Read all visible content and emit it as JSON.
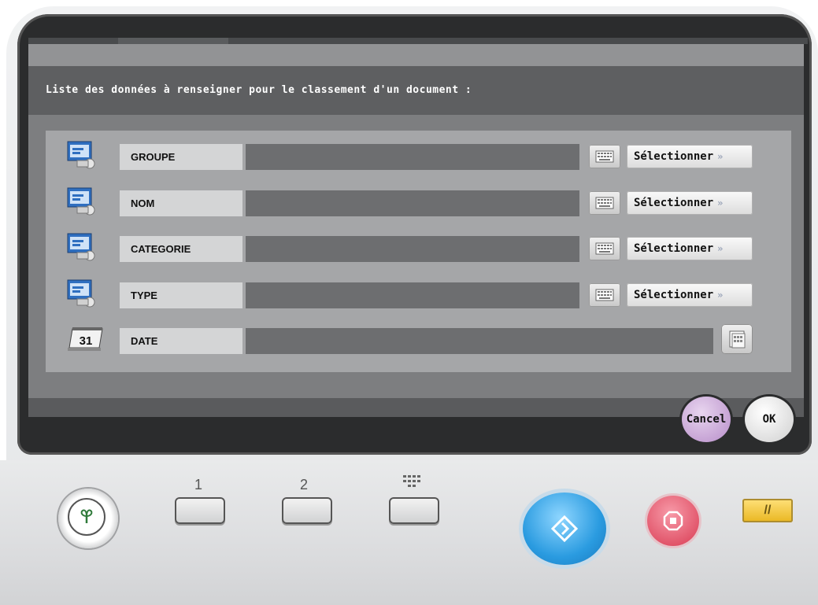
{
  "screen": {
    "instruction": "Liste des données à renseigner pour le classement d'un document :",
    "fields": [
      {
        "label": "GROUPE",
        "icon": "folder-list-icon",
        "select_label": "Sélectionner",
        "keyboard_icon": "keyboard-icon"
      },
      {
        "label": "NOM",
        "icon": "folder-list-icon",
        "select_label": "Sélectionner",
        "keyboard_icon": "keyboard-icon"
      },
      {
        "label": "CATEGORIE",
        "icon": "folder-list-icon",
        "select_label": "Sélectionner",
        "keyboard_icon": "keyboard-icon"
      },
      {
        "label": "TYPE",
        "icon": "folder-list-icon",
        "select_label": "Sélectionner",
        "keyboard_icon": "keyboard-icon"
      }
    ],
    "date_field": {
      "label": "DATE",
      "icon_text": "31",
      "icon": "calendar-icon",
      "picker_icon": "calendar-picker-icon"
    },
    "select_arrow": "»",
    "cancel_label": "Cancel",
    "ok_label": "OK"
  },
  "hardware": {
    "memory_1_label": "1",
    "memory_2_label": "2",
    "keypad_icon": "keypad-icon",
    "power_icon": "power-save-icon",
    "start_icon": "start-icon",
    "stop_icon": "stop-icon",
    "reset_icon": "reset-icon",
    "reset_symbol": "//"
  },
  "colors": {
    "screen_bg": "#7d7e80",
    "panel_bg": "#a5a6a8",
    "field_bg": "#6d6e70",
    "start_blue": "#2a9be0",
    "stop_red": "#d93a52",
    "reset_yellow": "#f2c63e",
    "cancel_purple": "#c7a2d6"
  }
}
